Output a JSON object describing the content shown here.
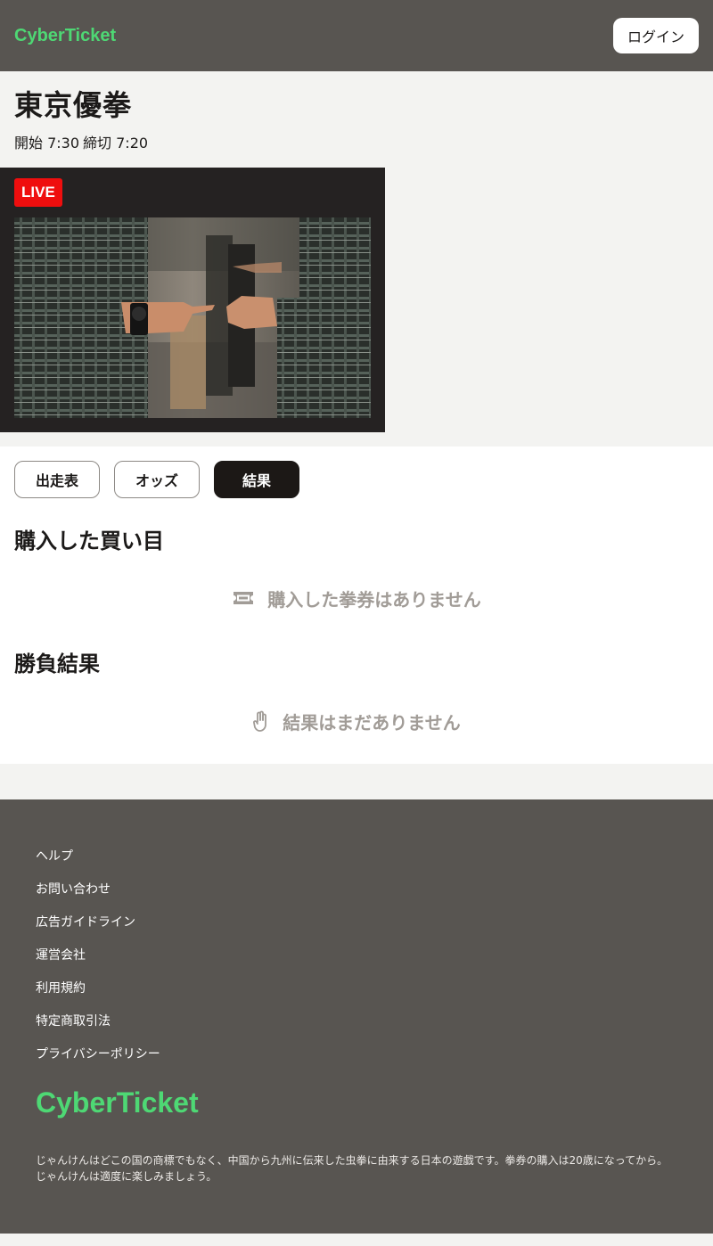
{
  "header": {
    "brand": "CyberTicket",
    "login_label": "ログイン"
  },
  "race": {
    "title": "東京優拳",
    "start": "開始 7:30",
    "close": "締切 7:20"
  },
  "live": {
    "badge": "LIVE"
  },
  "tabs": [
    {
      "label": "出走表",
      "active": false
    },
    {
      "label": "オッズ",
      "active": false
    },
    {
      "label": "結果",
      "active": true
    }
  ],
  "purchased": {
    "title": "購入した買い目",
    "empty_text": "購入した拳券はありません",
    "icon": "ticket-icon"
  },
  "results": {
    "title": "勝負結果",
    "empty_text": "結果はまだありません",
    "icon": "hand-icon"
  },
  "footer": {
    "links": [
      "ヘルプ",
      "お問い合わせ",
      "広告ガイドライン",
      "運営会社",
      "利用規約",
      "特定商取引法",
      "プライバシーポリシー"
    ],
    "brand": "CyberTicket",
    "note": "じゃんけんはどこの国の商標でもなく、中国から九州に伝来した虫拳に由来する日本の遊戯です。拳券の購入は20歳になってから。じゃんけんは適度に楽しみましょう。"
  },
  "colors": {
    "brand_green": "#4ed874",
    "header_bg": "#585551",
    "live_red": "#ef0e0e",
    "active_tab": "#1c1816",
    "muted": "#a19c97"
  }
}
